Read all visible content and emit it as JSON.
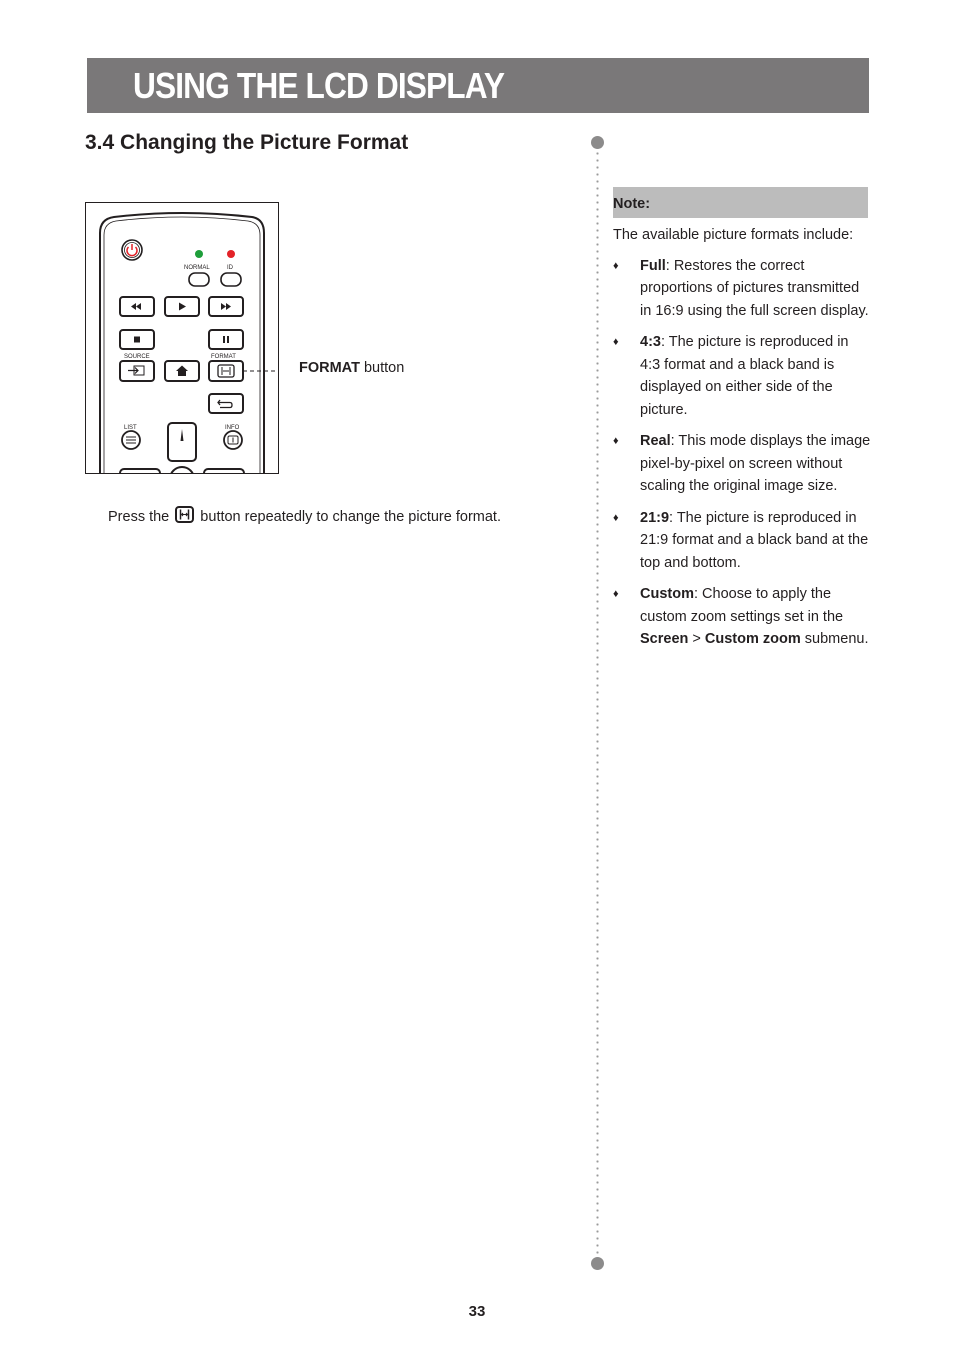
{
  "header": {
    "title": "USING THE LCD DISPLAY"
  },
  "section": {
    "title": "3.4 Changing the Picture Format"
  },
  "remote": {
    "labels": {
      "normal": "NORMAL",
      "id": "ID",
      "source": "SOURCE",
      "format": "FORMAT",
      "list": "LIST",
      "info": "INFO"
    },
    "led_colors": {
      "normal": "#1e9e3a",
      "id": "#e32228"
    },
    "power_color": "#e32228"
  },
  "callout": {
    "bold": "FORMAT",
    "rest": " button"
  },
  "instruction": {
    "before": "Press the ",
    "icon": "format-icon",
    "after": " button repeatedly to change the picture format."
  },
  "note": {
    "heading": "Note:",
    "intro": "The available picture formats include:",
    "bullet_glyph": "♦",
    "items": [
      {
        "term": "Full",
        "text": ": Restores the correct proportions of pictures transmitted in 16:9 using the full screen display."
      },
      {
        "term": "4:3",
        "text": ": The picture is reproduced in 4:3 format and a black band is displayed on either side of the picture."
      },
      {
        "term": "Real",
        "text": ": This mode displays the image pixel-by-pixel on screen without scaling the original image size."
      },
      {
        "term": "21:9",
        "text": ": The picture is reproduced in 21:9 format and a black band at the top and bottom."
      },
      {
        "term": "Custom",
        "text": ": Choose to apply the custom zoom settings set in the ",
        "term2": "Screen",
        "mid": " > ",
        "term3": "Custom zoom",
        "tail": " submenu."
      }
    ]
  },
  "footer": {
    "page_number": "33"
  }
}
